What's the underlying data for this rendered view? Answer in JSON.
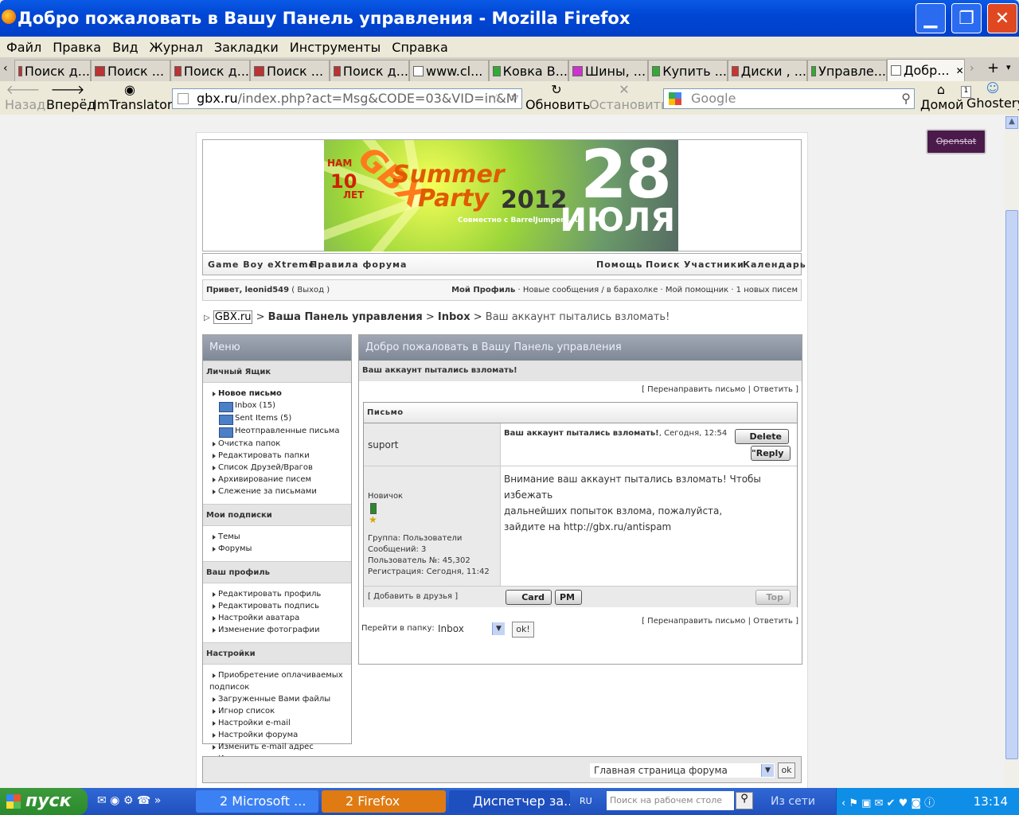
{
  "window": {
    "title": "Добро пожаловать в Вашу Панель управления - Mozilla Firefox"
  },
  "menubar": [
    "Файл",
    "Правка",
    "Вид",
    "Журнал",
    "Закладки",
    "Инструменты",
    "Справка"
  ],
  "tabs": [
    "Поиск д...",
    "Поиск ...",
    "Поиск д...",
    "Поиск ...",
    "Поиск д...",
    "www.cl...",
    "Ковка В...",
    "Шины, ...",
    "Купить ...",
    "Диски , ...",
    "Управле...",
    "Добр..."
  ],
  "nav": {
    "back": "Назад",
    "forward": "Вперёд",
    "imtranslator": "ImTranslator",
    "reload": "Обновить",
    "stop": "Остановить",
    "home": "Домой",
    "ghostery": "Ghostery",
    "url_host": "gbx.ru",
    "url_rest": "/index.php?act=Msg&CODE=03&VID=in&M",
    "search_placeholder": "Google",
    "ghostery_count": "1"
  },
  "openstat": "Openstat",
  "banner": {
    "nam": "НАМ",
    "ten": "10",
    "let": "ЛЕТ",
    "gbx": "GBX",
    "summer": "Summer",
    "party": "Party",
    "year": "2012",
    "day": "28",
    "month": "ИЮЛЯ",
    "with": "Совместно с BarrelJumpers.ru"
  },
  "topnav": {
    "left": [
      "Game Boy eXtreme",
      "Правила форума"
    ],
    "right": [
      "Помощь",
      "Поиск",
      "Участники",
      "Календарь"
    ]
  },
  "welcome": {
    "hello": "Привет,",
    "user": "leonid549",
    "logout": "( Выход )",
    "links": "Мой Профиль · Новые сообщения / в барахолке · Мой помощник · 1 новых писем",
    "profile": "Мой Профиль",
    "rest": " · Новые сообщения / в барахолке · Мой помощник · 1 новых писем"
  },
  "breadcrumb": {
    "root": "GBX.ru",
    "sep": ">",
    "panel": "Ваша Панель управления",
    "inbox": "Inbox",
    "current": "Ваш аккаунт пытались взломать!"
  },
  "menu": {
    "title": "Меню",
    "sections": [
      {
        "head": "Личный Ящик"
      },
      {
        "head": "Мои подписки"
      },
      {
        "head": "Ваш профиль"
      },
      {
        "head": "Настройки"
      }
    ],
    "mailbox": {
      "new": "Новое письмо",
      "folders": [
        "Inbox (15)",
        "Sent Items (5)",
        "Неотправленные письма"
      ],
      "items": [
        "Очистка папок",
        "Редактировать папки",
        "Список Друзей/Врагов",
        "Архивирование писем",
        "Слежение за письмами"
      ]
    },
    "subs": [
      "Темы",
      "Форумы"
    ],
    "profile": [
      "Редактировать профиль",
      "Редактировать подпись",
      "Настройки аватара",
      "Изменение фотографии"
    ],
    "settings_first": "Приобретение оплачиваемых",
    "settings_first2": "подписок",
    "settings": [
      "Загруженные Вами файлы",
      "Игнор список",
      "Настройки e-mail",
      "Настройки форума",
      "Изменить e-mail адрес",
      "Изменить пароль"
    ]
  },
  "content": {
    "title": "Добро пожаловать в Вашу Панель управления",
    "subject": "Ваш аккаунт пытались взломать!",
    "forward": "[ Перенаправить письмо | Ответить ]",
    "letter_head": "Письмо",
    "author": "suport",
    "msg_title": "Ваш аккаунт пытались взломать!",
    "msg_time": ", Сегодня, 12:54",
    "delete": "Delete",
    "reply": "Reply",
    "rank": "Новичок",
    "group": "Группа: Пользователи",
    "posts": "Сообщений: 3",
    "userno": "Пользователь №: 45,302",
    "reg": "Регистрация: Сегодня, 11:42",
    "body1": "Внимание ваш аккаунт пытались взломать! Чтобы избежать",
    "body2": "дальнейших попыток взлома, пожалуйста,",
    "body3": "зайдите на http://gbx.ru/antispam",
    "add_friend": "[ Добавить в друзья ]",
    "card": "Card",
    "pm": "PM",
    "top": "Top",
    "goto_label": "Перейти в папку:",
    "goto_value": "Inbox",
    "ok": "ok!"
  },
  "footer": {
    "jump": "Главная страница форума",
    "ok": "ok"
  },
  "taskbar": {
    "start": "пуск",
    "tasks": [
      "2 Microsoft ...",
      "2 Firefox",
      "Диспетчер за..."
    ],
    "lang": "RU",
    "search": "Поиск на рабочем столе",
    "net": "Из сети",
    "clock": "13:14"
  }
}
